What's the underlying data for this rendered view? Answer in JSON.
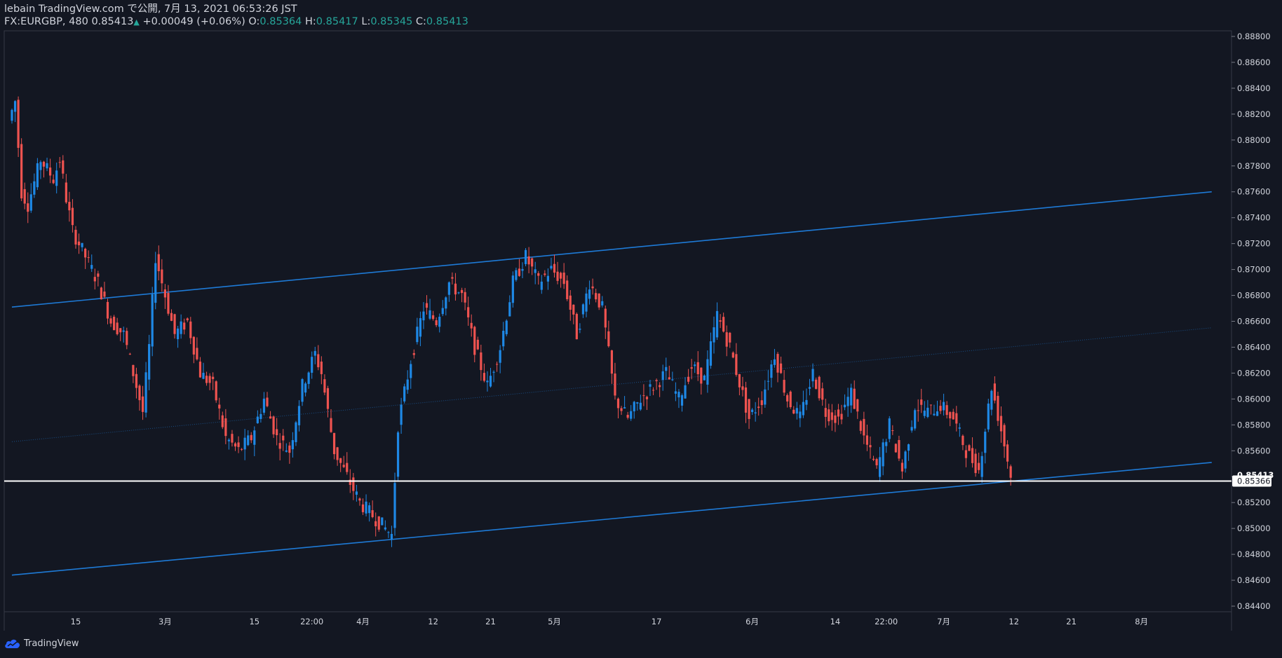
{
  "header": {
    "line1": "lebain TradingView.com で公開, 7月 13, 2021 06:53:26 JST",
    "symbol_interval": "FX:EURGBP, 480",
    "last_price": "0.85413",
    "change_arrow": "▲",
    "change": "+0.00049 (+0.06%)",
    "o_label": "O:",
    "o_value": "0.85364",
    "h_label": "H:",
    "h_value": "0.85417",
    "l_label": "L:",
    "l_value": "0.85345",
    "c_label": "C:",
    "c_value": "0.85413"
  },
  "footer": {
    "brand": "TradingView",
    "logo_icon": "tradingview-cloud-icon"
  },
  "colors": {
    "background": "#131722",
    "up": "#1e88e5",
    "down": "#ef5350",
    "trendline": "#1e7ad6",
    "axis_text": "#d1d4dc",
    "grid_border": "#363a45"
  },
  "chart_data": {
    "type": "candlestick",
    "title": "FX:EURGBP, 480",
    "y_axis": {
      "min": 0.844,
      "max": 0.889,
      "side": "right",
      "ticks": [
        "0.88800",
        "0.88600",
        "0.88400",
        "0.88200",
        "0.88000",
        "0.87800",
        "0.87600",
        "0.87400",
        "0.87200",
        "0.87000",
        "0.86800",
        "0.86600",
        "0.86400",
        "0.86200",
        "0.86000",
        "0.85800",
        "0.85600",
        "0.85400",
        "0.85200",
        "0.85000",
        "0.84800",
        "0.84600",
        "0.84400"
      ],
      "price_labels": [
        {
          "text": "0.85413",
          "value": 0.85413,
          "style": "last"
        },
        {
          "text": "0.85366",
          "value": 0.85366,
          "style": "horizontal-line"
        }
      ]
    },
    "x_axis": {
      "ticks": [
        {
          "label": "15",
          "date": "2021-02-15"
        },
        {
          "label": "3月",
          "date": "2021-03-01"
        },
        {
          "label": "15",
          "date": "2021-03-15"
        },
        {
          "label": "22:00",
          "date": "2021-03-24"
        },
        {
          "label": "4月",
          "date": "2021-04-01"
        },
        {
          "label": "12",
          "date": "2021-04-12"
        },
        {
          "label": "21",
          "date": "2021-04-21"
        },
        {
          "label": "5月",
          "date": "2021-05-01"
        },
        {
          "label": "17",
          "date": "2021-05-17"
        },
        {
          "label": "6月",
          "date": "2021-06-01"
        },
        {
          "label": "14",
          "date": "2021-06-14"
        },
        {
          "label": "22:00",
          "date": "2021-06-22"
        },
        {
          "label": "7月",
          "date": "2021-07-01"
        },
        {
          "label": "12",
          "date": "2021-07-12"
        },
        {
          "label": "21",
          "date": "2021-07-21"
        },
        {
          "label": "8月",
          "date": "2021-08-01"
        }
      ]
    },
    "price_path": [
      {
        "date": "2021-02-05",
        "price": 0.8815
      },
      {
        "date": "2021-02-06",
        "price": 0.883
      },
      {
        "date": "2021-02-07",
        "price": 0.876
      },
      {
        "date": "2021-02-08",
        "price": 0.875
      },
      {
        "date": "2021-02-10",
        "price": 0.8785
      },
      {
        "date": "2021-02-12",
        "price": 0.877
      },
      {
        "date": "2021-02-13",
        "price": 0.8785
      },
      {
        "date": "2021-02-14",
        "price": 0.8755
      },
      {
        "date": "2021-02-15",
        "price": 0.873
      },
      {
        "date": "2021-02-17",
        "price": 0.871
      },
      {
        "date": "2021-02-19",
        "price": 0.869
      },
      {
        "date": "2021-02-21",
        "price": 0.866
      },
      {
        "date": "2021-02-23",
        "price": 0.865
      },
      {
        "date": "2021-02-25",
        "price": 0.861
      },
      {
        "date": "2021-02-26",
        "price": 0.859
      },
      {
        "date": "2021-02-27",
        "price": 0.864
      },
      {
        "date": "2021-02-28",
        "price": 0.871
      },
      {
        "date": "2021-03-01",
        "price": 0.869
      },
      {
        "date": "2021-03-03",
        "price": 0.865
      },
      {
        "date": "2021-03-05",
        "price": 0.866
      },
      {
        "date": "2021-03-07",
        "price": 0.862
      },
      {
        "date": "2021-03-09",
        "price": 0.861
      },
      {
        "date": "2021-03-11",
        "price": 0.857
      },
      {
        "date": "2021-03-13",
        "price": 0.856
      },
      {
        "date": "2021-03-15",
        "price": 0.857
      },
      {
        "date": "2021-03-17",
        "price": 0.86
      },
      {
        "date": "2021-03-19",
        "price": 0.857
      },
      {
        "date": "2021-03-21",
        "price": 0.856
      },
      {
        "date": "2021-03-23",
        "price": 0.861
      },
      {
        "date": "2021-03-25",
        "price": 0.8635
      },
      {
        "date": "2021-03-26",
        "price": 0.862
      },
      {
        "date": "2021-03-28",
        "price": 0.856
      },
      {
        "date": "2021-03-30",
        "price": 0.854
      },
      {
        "date": "2021-04-01",
        "price": 0.852
      },
      {
        "date": "2021-04-03",
        "price": 0.851
      },
      {
        "date": "2021-04-05",
        "price": 0.85
      },
      {
        "date": "2021-04-06",
        "price": 0.8495
      },
      {
        "date": "2021-04-07",
        "price": 0.858
      },
      {
        "date": "2021-04-09",
        "price": 0.863
      },
      {
        "date": "2021-04-11",
        "price": 0.867
      },
      {
        "date": "2021-04-13",
        "price": 0.866
      },
      {
        "date": "2021-04-15",
        "price": 0.869
      },
      {
        "date": "2021-04-17",
        "price": 0.868
      },
      {
        "date": "2021-04-19",
        "price": 0.864
      },
      {
        "date": "2021-04-21",
        "price": 0.861
      },
      {
        "date": "2021-04-23",
        "price": 0.864
      },
      {
        "date": "2021-04-25",
        "price": 0.869
      },
      {
        "date": "2021-04-27",
        "price": 0.871
      },
      {
        "date": "2021-04-29",
        "price": 0.869
      },
      {
        "date": "2021-05-01",
        "price": 0.87
      },
      {
        "date": "2021-05-03",
        "price": 0.869
      },
      {
        "date": "2021-05-05",
        "price": 0.865
      },
      {
        "date": "2021-05-07",
        "price": 0.869
      },
      {
        "date": "2021-05-09",
        "price": 0.867
      },
      {
        "date": "2021-05-11",
        "price": 0.86
      },
      {
        "date": "2021-05-13",
        "price": 0.8585
      },
      {
        "date": "2021-05-15",
        "price": 0.86
      },
      {
        "date": "2021-05-17",
        "price": 0.861
      },
      {
        "date": "2021-05-19",
        "price": 0.862
      },
      {
        "date": "2021-05-21",
        "price": 0.86
      },
      {
        "date": "2021-05-23",
        "price": 0.8625
      },
      {
        "date": "2021-05-25",
        "price": 0.8615
      },
      {
        "date": "2021-05-27",
        "price": 0.8665
      },
      {
        "date": "2021-05-29",
        "price": 0.864
      },
      {
        "date": "2021-06-01",
        "price": 0.8585
      },
      {
        "date": "2021-06-03",
        "price": 0.86
      },
      {
        "date": "2021-06-05",
        "price": 0.8635
      },
      {
        "date": "2021-06-07",
        "price": 0.86
      },
      {
        "date": "2021-06-09",
        "price": 0.8585
      },
      {
        "date": "2021-06-11",
        "price": 0.862
      },
      {
        "date": "2021-06-13",
        "price": 0.859
      },
      {
        "date": "2021-06-15",
        "price": 0.8585
      },
      {
        "date": "2021-06-17",
        "price": 0.8605
      },
      {
        "date": "2021-06-19",
        "price": 0.857
      },
      {
        "date": "2021-06-21",
        "price": 0.8545
      },
      {
        "date": "2021-06-23",
        "price": 0.858
      },
      {
        "date": "2021-06-25",
        "price": 0.8545
      },
      {
        "date": "2021-06-27",
        "price": 0.8595
      },
      {
        "date": "2021-06-29",
        "price": 0.859
      },
      {
        "date": "2021-07-01",
        "price": 0.8595
      },
      {
        "date": "2021-07-03",
        "price": 0.8585
      },
      {
        "date": "2021-07-05",
        "price": 0.856
      },
      {
        "date": "2021-07-07",
        "price": 0.8545
      },
      {
        "date": "2021-07-09",
        "price": 0.861
      },
      {
        "date": "2021-07-11",
        "price": 0.8565
      },
      {
        "date": "2021-07-12",
        "price": 0.8541
      }
    ],
    "trendlines": [
      {
        "name": "upper-channel",
        "from": {
          "date": "2021-02-05",
          "price": 0.8671
        },
        "to": {
          "date": "2021-08-12",
          "price": 0.876
        },
        "style": "solid"
      },
      {
        "name": "middle-channel",
        "from": {
          "date": "2021-02-05",
          "price": 0.8567
        },
        "to": {
          "date": "2021-08-12",
          "price": 0.8655
        },
        "style": "dotted"
      },
      {
        "name": "lower-channel",
        "from": {
          "date": "2021-02-05",
          "price": 0.8464
        },
        "to": {
          "date": "2021-08-12",
          "price": 0.8551
        },
        "style": "solid"
      }
    ],
    "horizontal_lines": [
      {
        "price": 0.85366,
        "color": "#ffffff"
      }
    ]
  }
}
